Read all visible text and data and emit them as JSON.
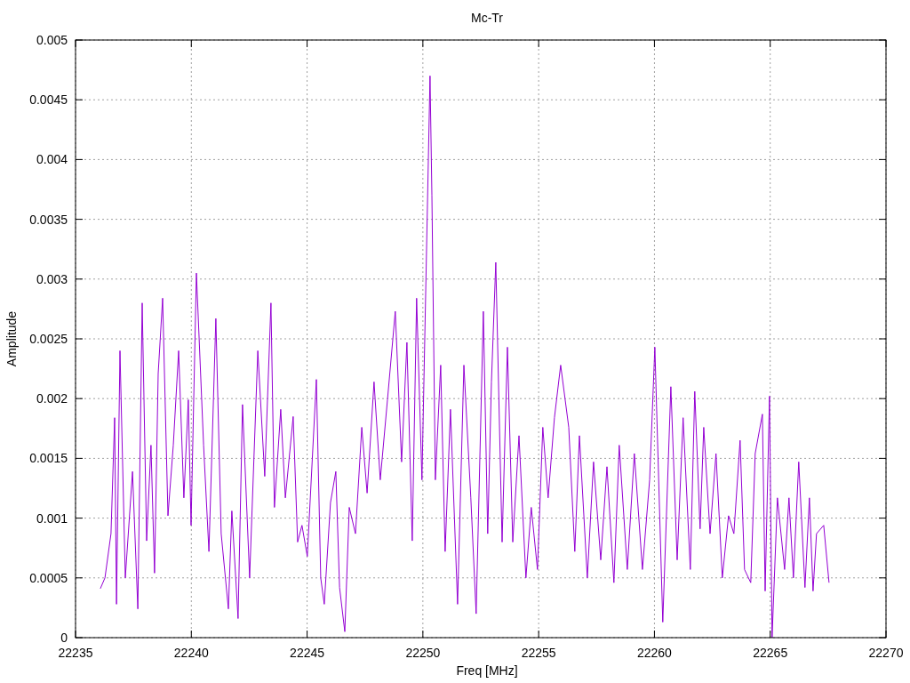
{
  "chart_data": {
    "type": "line",
    "title": "Mc-Tr",
    "xlabel": "Freq [MHz]",
    "ylabel": "Amplitude",
    "grid": true,
    "xlim": [
      22235,
      22270
    ],
    "ylim": [
      0,
      0.005
    ],
    "xticks": [
      22235,
      22240,
      22245,
      22250,
      22255,
      22260,
      22265,
      22270
    ],
    "yticks": [
      0,
      0.0005,
      0.001,
      0.0015,
      0.002,
      0.0025,
      0.003,
      0.0035,
      0.004,
      0.0045,
      0.005
    ],
    "x": [
      22236.07,
      22236.27,
      22236.53,
      22236.69,
      22236.77,
      22236.92,
      22237.15,
      22237.46,
      22237.69,
      22237.88,
      22238.07,
      22238.26,
      22238.41,
      22238.57,
      22238.76,
      22238.99,
      22239.22,
      22239.45,
      22239.68,
      22239.87,
      22239.99,
      22240.22,
      22240.53,
      22240.76,
      22241.06,
      22241.29,
      22241.6,
      22241.75,
      22242.02,
      22242.21,
      22242.52,
      22242.87,
      22243.17,
      22243.44,
      22243.59,
      22243.86,
      22244.06,
      22244.4,
      22244.59,
      22244.78,
      22245.01,
      22245.4,
      22245.59,
      22245.74,
      22246.01,
      22246.24,
      22246.4,
      22246.63,
      22246.82,
      22247.09,
      22247.36,
      22247.59,
      22247.89,
      22248.16,
      22248.47,
      22248.81,
      22249.08,
      22249.31,
      22249.54,
      22249.73,
      22249.96,
      22250.31,
      22250.39,
      22250.54,
      22250.77,
      22250.96,
      22251.19,
      22251.5,
      22251.77,
      22252.07,
      22252.3,
      22252.61,
      22252.8,
      22252.96,
      22253.15,
      22253.42,
      22253.65,
      22253.88,
      22254.15,
      22254.45,
      22254.68,
      22254.95,
      22255.18,
      22255.41,
      22255.68,
      22255.95,
      22256.3,
      22256.56,
      22256.76,
      22257.1,
      22257.37,
      22257.68,
      22257.95,
      22258.25,
      22258.48,
      22258.83,
      22259.13,
      22259.48,
      22259.79,
      22260.02,
      22260.36,
      22260.71,
      22260.98,
      22261.24,
      22261.55,
      22261.74,
      22261.97,
      22262.13,
      22262.4,
      22262.66,
      22262.93,
      22263.2,
      22263.43,
      22263.7,
      22263.89,
      22264.16,
      22264.35,
      22264.66,
      22264.78,
      22264.97,
      22265.08,
      22265.31,
      22265.62,
      22265.81,
      22266,
      22266.23,
      22266.5,
      22266.69,
      22266.85,
      22267,
      22267.31,
      22267.54
    ],
    "series": [
      {
        "color": "#9400d3",
        "values": [
          0.00041,
          0.0005,
          0.00087,
          0.00184,
          0.00028,
          0.0024,
          0.0005,
          0.00139,
          0.00024,
          0.0028,
          0.00081,
          0.00161,
          0.00054,
          0.00221,
          0.00284,
          0.00102,
          0.00161,
          0.0024,
          0.00117,
          0.00199,
          0.00094,
          0.00305,
          0.00161,
          0.00072,
          0.00267,
          0.00087,
          0.00024,
          0.00106,
          0.00016,
          0.00195,
          0.0005,
          0.0024,
          0.00135,
          0.0028,
          0.00109,
          0.00191,
          0.00117,
          0.00185,
          0.0008,
          0.00094,
          0.00068,
          0.00216,
          0.0005,
          0.00028,
          0.00113,
          0.00139,
          0.00042,
          5e-05,
          0.00109,
          0.00087,
          0.00176,
          0.00121,
          0.00214,
          0.00132,
          0.00199,
          0.00273,
          0.00147,
          0.00247,
          0.00081,
          0.00284,
          0.00132,
          0.0047,
          0.0037,
          0.00132,
          0.00228,
          0.00072,
          0.00191,
          0.00028,
          0.00228,
          0.00117,
          0.0002,
          0.00273,
          0.00087,
          0.00214,
          0.00314,
          0.0008,
          0.00243,
          0.0008,
          0.00169,
          0.0005,
          0.00109,
          0.00057,
          0.00176,
          0.00117,
          0.00184,
          0.00228,
          0.00176,
          0.00072,
          0.00169,
          0.0005,
          0.00147,
          0.00065,
          0.00143,
          0.00046,
          0.00161,
          0.00057,
          0.00154,
          0.00057,
          0.00132,
          0.00243,
          0.00013,
          0.0021,
          0.00065,
          0.00184,
          0.00057,
          0.00206,
          0.00091,
          0.00176,
          0.00087,
          0.00154,
          0.0005,
          0.00102,
          0.00087,
          0.00165,
          0.00057,
          0.00046,
          0.00154,
          0.00187,
          0.00039,
          0.00202,
          0,
          0.00117,
          0.00057,
          0.00117,
          0.0005,
          0.00147,
          0.00042,
          0.00117,
          0.00039,
          0.00087,
          0.00094,
          0.00046
        ]
      }
    ]
  }
}
